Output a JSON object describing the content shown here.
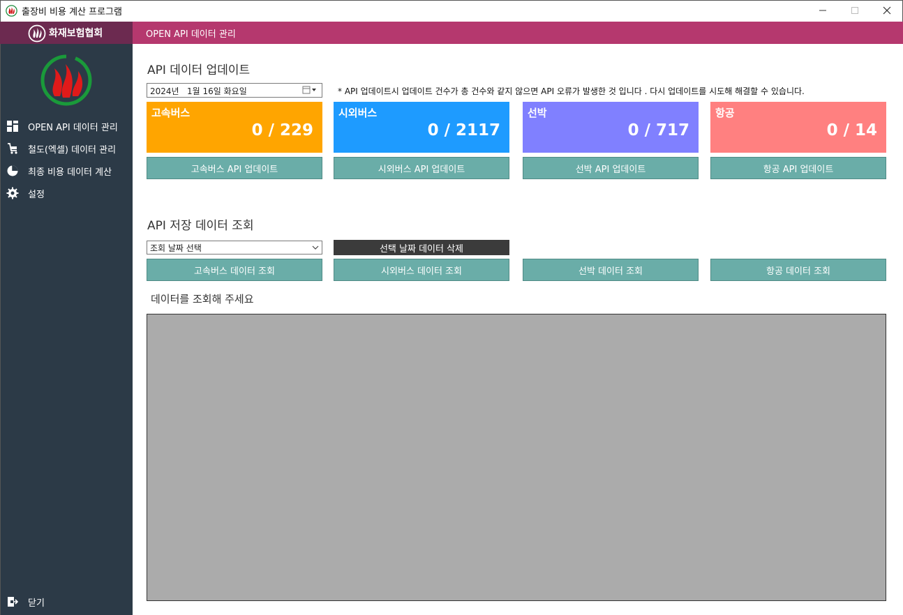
{
  "window": {
    "title": "출장비 비용 계산 프로그램"
  },
  "brand": {
    "name": "화재보험협회"
  },
  "header": {
    "title": "OPEN API 데이터 관리"
  },
  "sidebar": {
    "items": [
      {
        "label": "OPEN API 데이터 관리",
        "icon": "dashboard-icon"
      },
      {
        "label": "철도(엑셀) 데이터 관리",
        "icon": "cart-icon"
      },
      {
        "label": "최종 비용 데이터 계산",
        "icon": "pie-chart-icon"
      },
      {
        "label": "설정",
        "icon": "gear-icon"
      }
    ],
    "close_label": "닫기"
  },
  "update_section": {
    "title": "API 데이터 업데이트",
    "date_value": "2024년   1월 16일 화요일",
    "note": "* API 업데이트시 업데이트 건수가 총 건수와 같지 않으면 API 오류가 발생한 것 입니다 . 다시 업데이트를 시도해 해결할 수 있습니다.",
    "cards": [
      {
        "name": "고속버스",
        "count": "0 / 229",
        "color": "#ffa500"
      },
      {
        "name": "시외버스",
        "count": "0 / 2117",
        "color": "#1e9bff"
      },
      {
        "name": "선박",
        "count": "0 / 717",
        "color": "#8080ff"
      },
      {
        "name": "항공",
        "count": "0 / 14",
        "color": "#ff8080"
      }
    ],
    "buttons": [
      "고속버스 API 업데이트",
      "시외버스 API 업데이트",
      "선박 API 업데이트",
      "항공 API 업데이트"
    ]
  },
  "query_section": {
    "title": "API 저장 데이터 조회",
    "select_value": "조회 날짜 선택",
    "delete_label": "선택 날짜 데이터 삭제",
    "buttons": [
      "고속버스 데이터 조회",
      "시외버스 데이터 조회",
      "선박 데이터 조회",
      "항공 데이터 조회"
    ],
    "hint": "데이터를 조회해 주세요"
  },
  "colors": {
    "accent": "#b5386e",
    "sidebar": "#2c3a47",
    "button": "#6aada8"
  }
}
